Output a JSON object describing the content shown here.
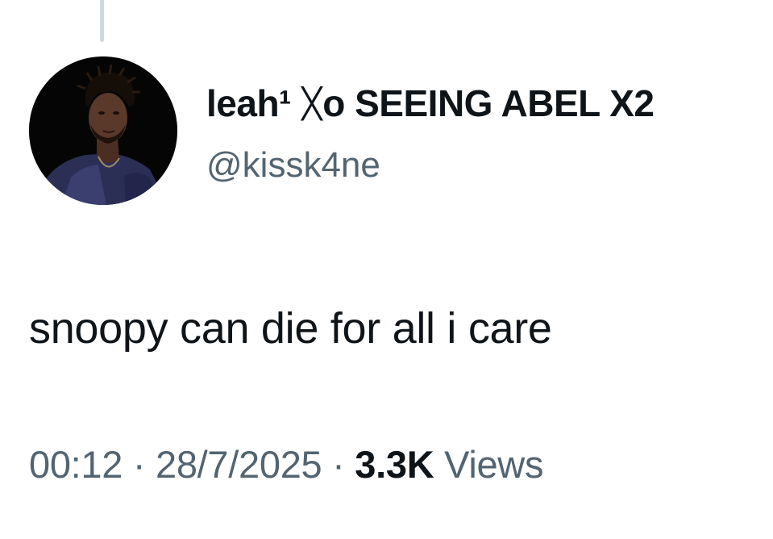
{
  "tweet": {
    "author": {
      "display_name": "leah¹ ᚷo SEEING ABEL X2",
      "handle": "@kissk4ne",
      "avatar_icon": "profile-photo"
    },
    "text": "snoopy can die for all i care",
    "meta": {
      "time": "00:12",
      "separator": " · ",
      "date": "28/7/2025",
      "views_count": "3.3K",
      "views_label": " Views"
    }
  },
  "colors": {
    "primary_text": "#0f1419",
    "secondary_text": "#536471",
    "thread_line": "#cfd9de",
    "background": "#ffffff"
  }
}
